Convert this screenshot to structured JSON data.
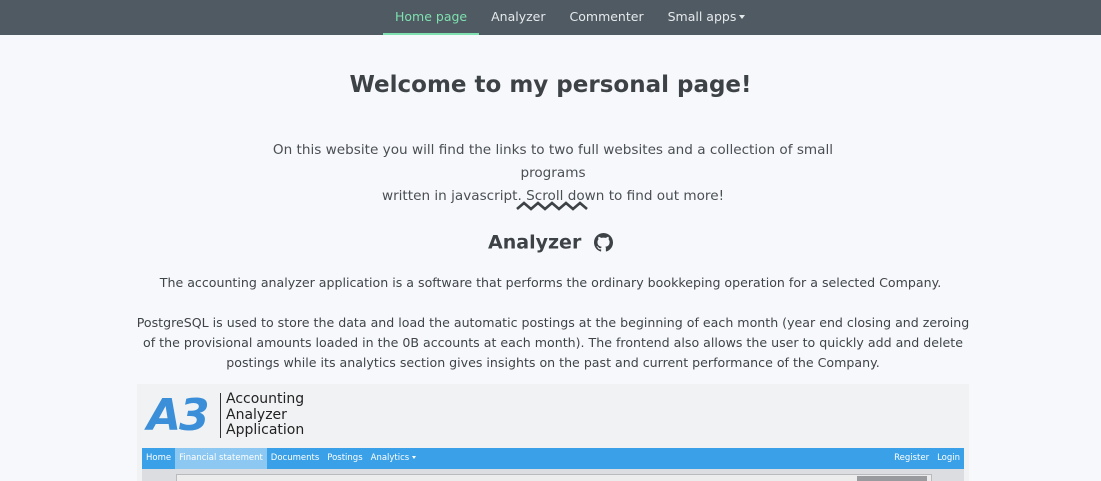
{
  "navbar": {
    "items": [
      {
        "label": "Home page",
        "active": true
      },
      {
        "label": "Analyzer"
      },
      {
        "label": "Commenter"
      },
      {
        "label": "Small apps",
        "dropdown": true
      }
    ],
    "bg_color": "#4f5a62",
    "active_color": "#7fe0b0"
  },
  "main": {
    "title": "Welcome to my personal page!",
    "intro_line1": "On this website you will find the links to two full websites and a collection of small programs",
    "intro_line2": "written in javascript. Scroll down to find out more!",
    "divider_icon": "zigzag-divider",
    "section": {
      "heading": "Analyzer",
      "icon": "github-icon",
      "desc1": "The accounting analyzer application is a software that performs the ordinary bookkeping operation for a selected Company.",
      "desc2": "PostgreSQL is used to store the data and load the automatic postings at the beginning of each month (year end closing and zeroing of the provisional amounts loaded in the 0B accounts at each month). The frontend also allows the user to quickly add and delete postings while its analytics section gives insights on the past and current performance of the Company."
    }
  },
  "preview": {
    "logo_mark": "A3",
    "logo_line1": "Accounting",
    "logo_line2": "Analyzer",
    "logo_line3": "Application",
    "logo_color": "#3b8fd8",
    "nav": {
      "home": "Home",
      "financial": "Financial statement",
      "documents": "Documents",
      "postings": "Postings",
      "analytics": "Analytics",
      "register": "Register",
      "login": "Login"
    },
    "nav_color": "#3aa0e8"
  }
}
